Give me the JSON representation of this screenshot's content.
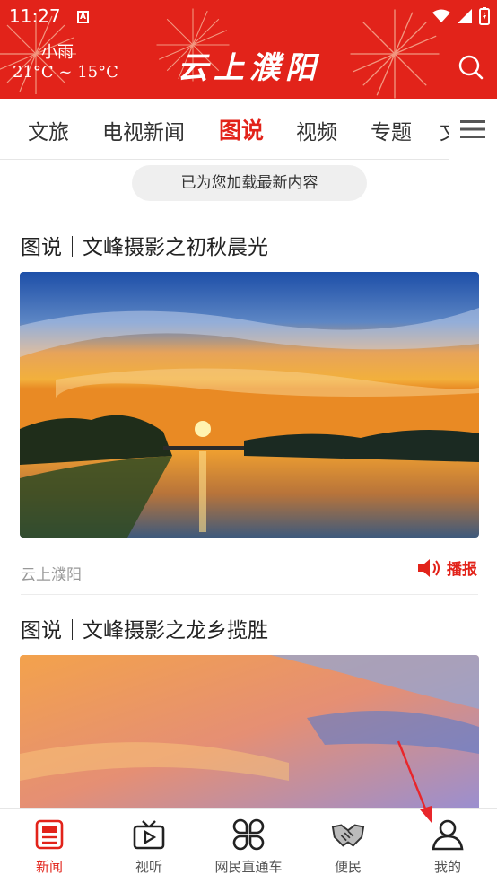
{
  "status_bar": {
    "time": "11:27",
    "badge": "A"
  },
  "header": {
    "weather_desc": "小雨",
    "weather_temp": "21°C ~ 15°C",
    "logo": "云上濮阳"
  },
  "tabs": [
    {
      "label": "文旅",
      "active": false
    },
    {
      "label": "电视新闻",
      "active": false
    },
    {
      "label": "图说",
      "active": true
    },
    {
      "label": "视频",
      "active": false
    },
    {
      "label": "专题",
      "active": false
    },
    {
      "label": "文",
      "active": false
    }
  ],
  "toast": "已为您加载最新内容",
  "articles": [
    {
      "title": "图说｜文峰摄影之初秋晨光",
      "source": "云上濮阳",
      "play_label": "播报"
    },
    {
      "title": "图说｜文峰摄影之龙乡揽胜"
    }
  ],
  "bottom_nav": [
    {
      "label": "新闻",
      "icon": "news-icon",
      "active": true
    },
    {
      "label": "视听",
      "icon": "tv-icon",
      "active": false
    },
    {
      "label": "网民直通车",
      "icon": "clover-icon",
      "active": false
    },
    {
      "label": "便民",
      "icon": "handshake-icon",
      "active": false
    },
    {
      "label": "我的",
      "icon": "user-icon",
      "active": false
    }
  ],
  "colors": {
    "brand": "#e2231a",
    "annotation_arrow": "#e8262b"
  }
}
